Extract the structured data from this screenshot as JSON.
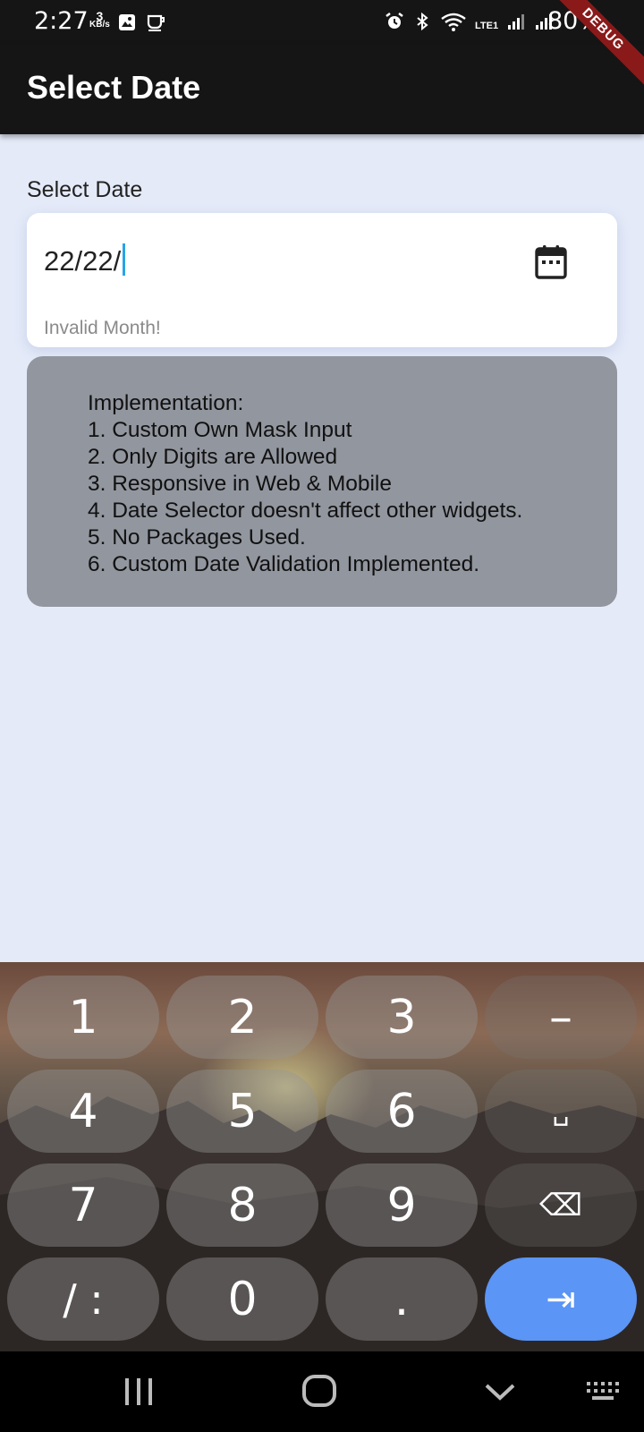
{
  "status_bar": {
    "time": "2:27",
    "kbs_value": "3",
    "kbs_unit": "KB/s",
    "network_label": "LTE1",
    "battery": "80%",
    "debug_banner": "DEBUG"
  },
  "app_bar": {
    "title": "Select Date"
  },
  "form": {
    "label": "Select Date",
    "value": "22/22/",
    "error": "Invalid Month!"
  },
  "info": {
    "lines": [
      "Implementation:",
      "1. Custom Own Mask Input",
      "2. Only Digits are Allowed",
      "3. Responsive in Web & Mobile",
      "4. Date Selector doesn't affect other widgets.",
      "5. No Packages Used.",
      "6. Custom Date Validation Implemented."
    ]
  },
  "keyboard": {
    "keys": [
      "1",
      "2",
      "3",
      "–",
      "4",
      "5",
      "6",
      "␣",
      "7",
      "8",
      "9",
      "⌫",
      "/ :",
      "0",
      ".",
      "⇥"
    ]
  },
  "colors": {
    "background": "#e4eaf8",
    "app_bar": "#151515",
    "cursor": "#2aa3e8",
    "info_card": "#92969f",
    "enter_key": "#5b95f5",
    "debug_ribbon": "#8a1a1a"
  }
}
